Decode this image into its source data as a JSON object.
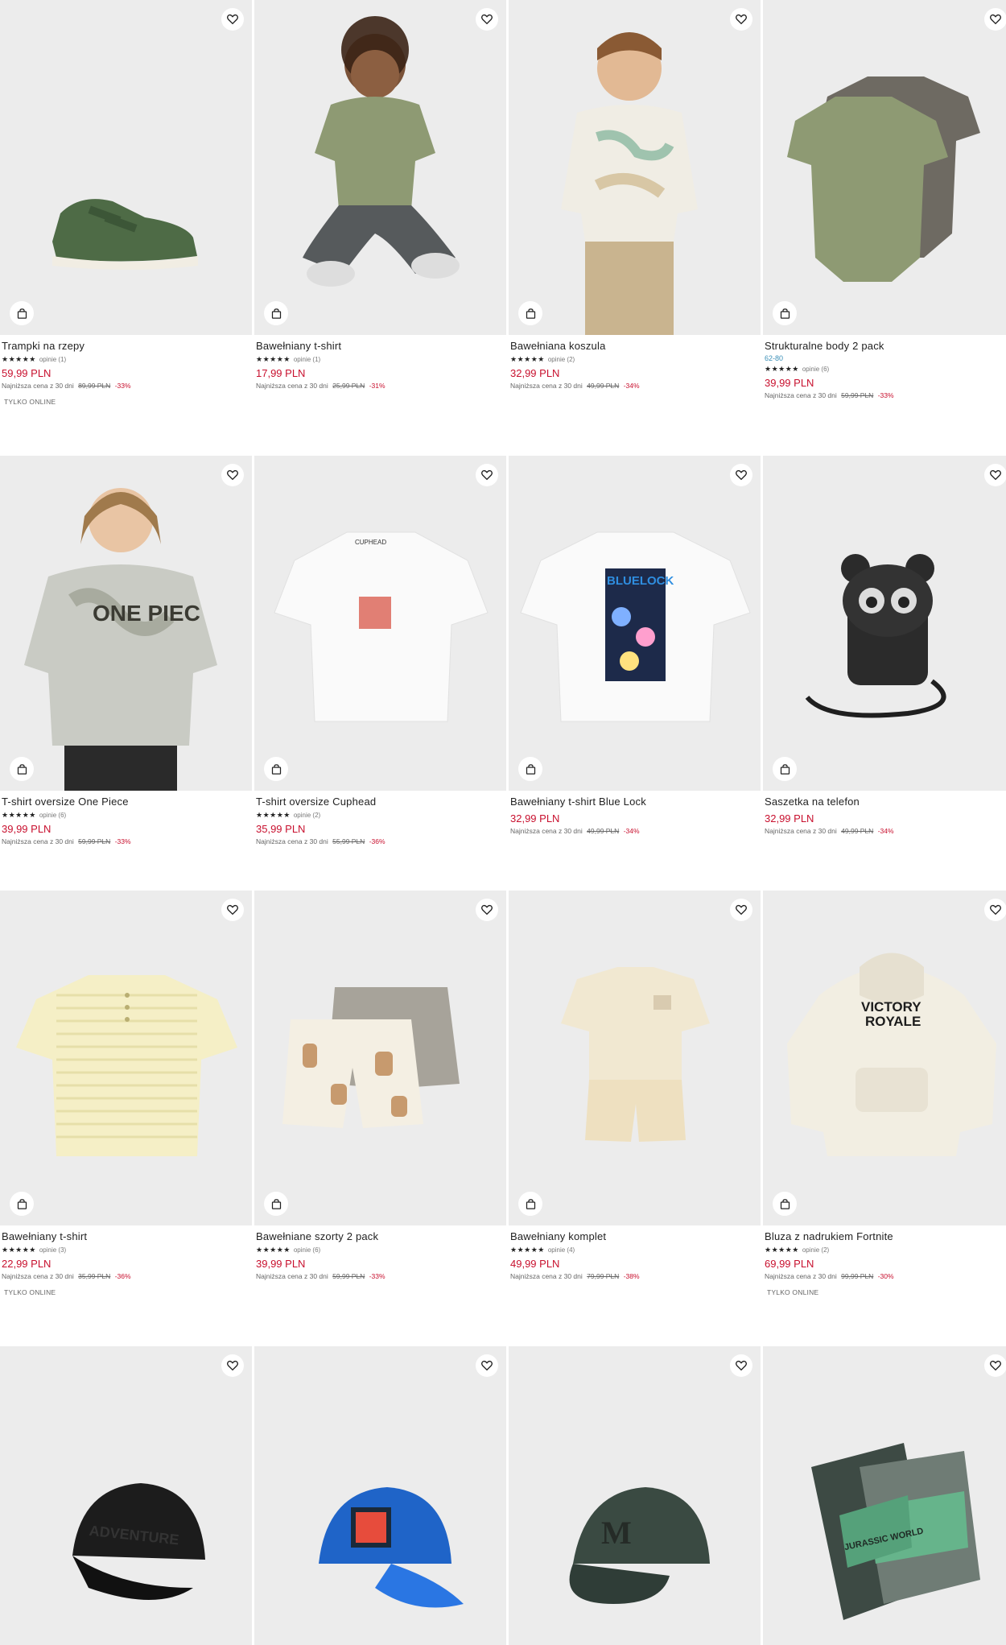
{
  "products": [
    {
      "name": "Trampki na rzepy",
      "sizes": "",
      "stars": "★★★★★",
      "reviews": "opinie (1)",
      "price": "59,99 PLN",
      "lowest_label": "Najniższa cena z 30 dni",
      "old_price": "89,99 PLN",
      "discount": "-33%",
      "badge": "TYLKO ONLINE",
      "image": "sneaker"
    },
    {
      "name": "Bawełniany t-shirt",
      "sizes": "",
      "stars": "★★★★★",
      "reviews": "opinie (1)",
      "price": "17,99 PLN",
      "lowest_label": "Najniższa cena z 30 dni",
      "old_price": "25,99 PLN",
      "discount": "-31%",
      "badge": "",
      "image": "child-olive-tshirt"
    },
    {
      "name": "Bawełniana koszula",
      "sizes": "",
      "stars": "★★★★★",
      "reviews": "opinie (2)",
      "price": "32,99 PLN",
      "lowest_label": "Najniższa cena z 30 dni",
      "old_price": "49,99 PLN",
      "discount": "-34%",
      "badge": "",
      "image": "child-shirt"
    },
    {
      "name": "Strukturalne body 2 pack",
      "sizes": "62-80",
      "stars": "★★★★★",
      "reviews": "opinie (6)",
      "price": "39,99 PLN",
      "lowest_label": "Najniższa cena z 30 dni",
      "old_price": "59,99 PLN",
      "discount": "-33%",
      "badge": "",
      "image": "bodysuits"
    },
    {
      "name": "T-shirt oversize One Piece",
      "sizes": "",
      "stars": "★★★★★",
      "reviews": "opinie (6)",
      "price": "39,99 PLN",
      "lowest_label": "Najniższa cena z 30 dni",
      "old_price": "59,99 PLN",
      "discount": "-33%",
      "badge": "",
      "image": "child-onepiece"
    },
    {
      "name": "T-shirt oversize Cuphead",
      "sizes": "",
      "stars": "★★★★★",
      "reviews": "opinie (2)",
      "price": "35,99 PLN",
      "lowest_label": "Najniższa cena z 30 dni",
      "old_price": "55,99 PLN",
      "discount": "-36%",
      "badge": "",
      "image": "white-tshirt-cuphead"
    },
    {
      "name": "Bawełniany t-shirt Blue Lock",
      "sizes": "",
      "stars": "",
      "reviews": "",
      "price": "32,99 PLN",
      "lowest_label": "Najniższa cena z 30 dni",
      "old_price": "49,99 PLN",
      "discount": "-34%",
      "badge": "",
      "image": "white-tshirt-bluelock"
    },
    {
      "name": "Saszetka na telefon",
      "sizes": "",
      "stars": "",
      "reviews": "",
      "price": "32,99 PLN",
      "lowest_label": "Najniższa cena z 30 dni",
      "old_price": "49,99 PLN",
      "discount": "-34%",
      "badge": "",
      "image": "phone-pouch"
    },
    {
      "name": "Bawełniany t-shirt",
      "sizes": "",
      "stars": "★★★★★",
      "reviews": "opinie (3)",
      "price": "22,99 PLN",
      "lowest_label": "Najniższa cena z 30 dni",
      "old_price": "35,99 PLN",
      "discount": "-36%",
      "badge": "TYLKO ONLINE",
      "image": "cream-henley"
    },
    {
      "name": "Bawełniane szorty 2 pack",
      "sizes": "",
      "stars": "★★★★★",
      "reviews": "opinie (6)",
      "price": "39,99 PLN",
      "lowest_label": "Najniższa cena z 30 dni",
      "old_price": "59,99 PLN",
      "discount": "-33%",
      "badge": "",
      "image": "shorts"
    },
    {
      "name": "Bawełniany komplet",
      "sizes": "",
      "stars": "★★★★★",
      "reviews": "opinie (4)",
      "price": "49,99 PLN",
      "lowest_label": "Najniższa cena z 30 dni",
      "old_price": "79,99 PLN",
      "discount": "-38%",
      "badge": "",
      "image": "shirt-set"
    },
    {
      "name": "Bluza z nadrukiem Fortnite",
      "sizes": "",
      "stars": "★★★★★",
      "reviews": "opinie (2)",
      "price": "69,99 PLN",
      "lowest_label": "Najniższa cena z 30 dni",
      "old_price": "99,99 PLN",
      "discount": "-30%",
      "badge": "TYLKO ONLINE",
      "image": "hoodie",
      "hoodie_text": [
        "VICTORY",
        "ROYALE"
      ]
    },
    {
      "name": "",
      "image": "black-cap",
      "cap_text": "ADVENTURE"
    },
    {
      "name": "",
      "image": "blue-cap"
    },
    {
      "name": "",
      "image": "green-cap"
    },
    {
      "name": "",
      "image": "slides",
      "slides_text": "JURASSIC WORLD"
    }
  ],
  "colors": {
    "price": "#c8102e",
    "sizes": "#3a8fb7",
    "image_bg": "#ececec"
  },
  "icons": {
    "favorite": "heart-icon",
    "add_to_cart": "shopping-bag-icon"
  }
}
